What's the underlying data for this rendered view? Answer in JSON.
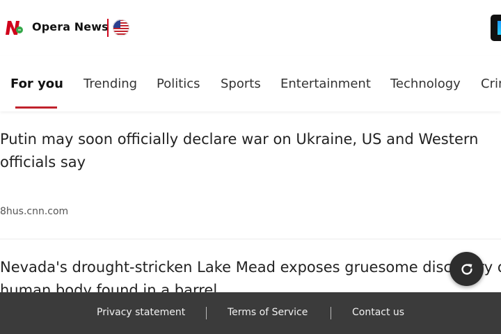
{
  "header": {
    "brand": "Opera News",
    "logo_icon": "opera-news-logo-icon",
    "region_icon": "us-flag-icon",
    "app_icon": "app-download-icon",
    "accent_color": "#d0021b"
  },
  "tabs": [
    {
      "label": "For you",
      "active": true
    },
    {
      "label": "Trending"
    },
    {
      "label": "Politics"
    },
    {
      "label": "Sports"
    },
    {
      "label": "Entertainment"
    },
    {
      "label": "Technology"
    },
    {
      "label": "Crime"
    }
  ],
  "articles": [
    {
      "title": "Putin may soon officially declare war on Ukraine, US and Western officials say",
      "source": "8hus.cnn.com"
    },
    {
      "title": "Nevada's drought-stricken Lake Mead exposes gruesome discovery of human body found in a barrel",
      "source": ""
    }
  ],
  "refresh_button": {
    "icon": "refresh-icon"
  },
  "footer": {
    "links": [
      "Privacy statement",
      "Terms of Service",
      "Contact us"
    ]
  }
}
